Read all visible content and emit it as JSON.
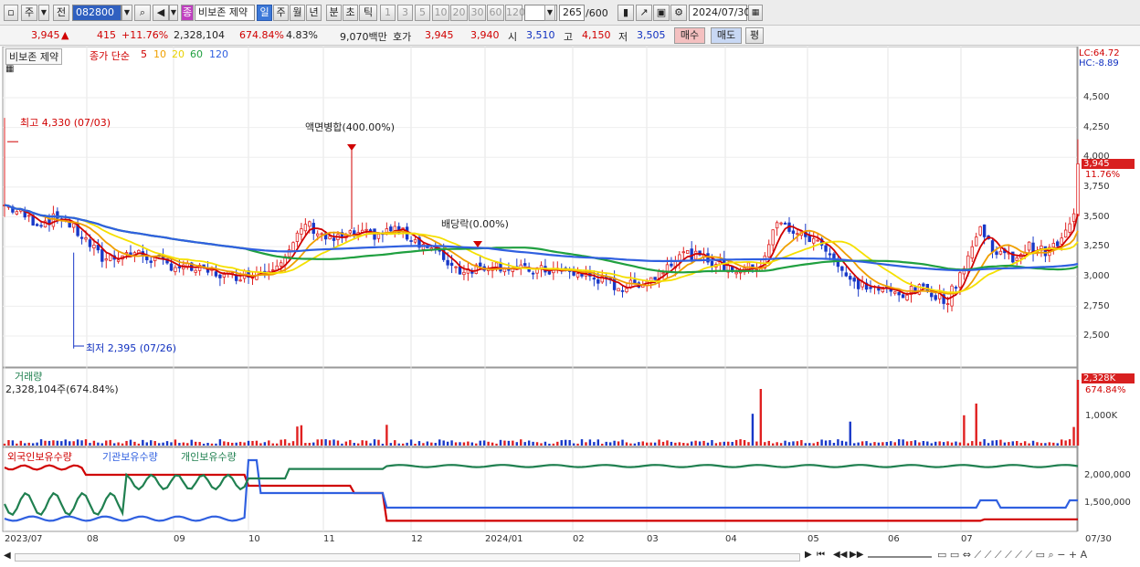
{
  "toolbar": {
    "market": "주",
    "prev": "전",
    "code": "082800",
    "name_tag": "종",
    "name": "비보존 제약",
    "periods": [
      "일",
      "주",
      "월",
      "년",
      "분",
      "초",
      "틱"
    ],
    "selected_period": "일",
    "intervals": [
      "1",
      "3",
      "5",
      "10",
      "20",
      "30",
      "60",
      "120"
    ],
    "count": "265",
    "count_max": "/600",
    "date": "2024/07/30"
  },
  "quote": {
    "price": "3,945",
    "arrow": "▲",
    "change": "415",
    "change_pct": "+11.76%",
    "volume": "2,328,104",
    "volume_pct": "674.84%",
    "turnover": "4.83%",
    "amount": "9,070백만",
    "ask_label": "호가",
    "ask": "3,945",
    "bid": "3,940",
    "open_label": "시",
    "open": "3,510",
    "high_label": "고",
    "high": "4,150",
    "low_label": "저",
    "low": "3,505",
    "buy": "매수",
    "sell": "매도",
    "eval": "평"
  },
  "price_panel": {
    "stock_label": "비보존 제약",
    "ma_label": "종가 단순",
    "ma_periods": [
      "5",
      "10",
      "20",
      "60",
      "120"
    ],
    "ma_colors": [
      "#d00000",
      "#f0a000",
      "#f5e000",
      "#20a040",
      "#3060e0"
    ],
    "lc": "LC:64.72",
    "hc": "HC:-8.89",
    "high_marker": "최고 4,330 (07/03)",
    "low_marker": "최저 2,395 (07/26)",
    "event1": "액면병합(400.00%)",
    "event2": "배당락(0.00%)",
    "current_price": "3,945",
    "current_pct": "11.76%",
    "yticks": [
      "4,500",
      "4,250",
      "4,000",
      "3,750",
      "3,500",
      "3,250",
      "3,000",
      "2,750",
      "2,500"
    ]
  },
  "volume_panel": {
    "title": "거래량",
    "value": "2,328,104주(674.84%)",
    "current": "2,328K",
    "current_pct": "674.84%",
    "ytick": "1,000K"
  },
  "holding_panel": {
    "series": [
      "외국인보유수량",
      "기관보유수량",
      "개인보유수량"
    ],
    "colors": [
      "#d00000",
      "#3060e0",
      "#208050"
    ],
    "yticks": [
      "2,000,000",
      "1,500,000"
    ]
  },
  "xaxis": [
    "2023/07",
    "08",
    "09",
    "10",
    "11",
    "12",
    "2024/01",
    "02",
    "03",
    "04",
    "05",
    "06",
    "07",
    "07/30"
  ],
  "chart_data": {
    "type": "candlestick",
    "x": [
      "2023/07",
      "08",
      "09",
      "10",
      "11",
      "12",
      "2024/01",
      "02",
      "03",
      "04",
      "05",
      "06",
      "07"
    ],
    "close_approx": [
      3500,
      3150,
      3000,
      3150,
      3250,
      3100,
      3050,
      2950,
      3200,
      3400,
      2900,
      3200,
      3200
    ],
    "last_close": 3945,
    "high": {
      "value": 4330,
      "date": "07/03"
    },
    "low": {
      "value": 2395,
      "date": "07/26"
    },
    "ylim": [
      2400,
      4700
    ]
  }
}
